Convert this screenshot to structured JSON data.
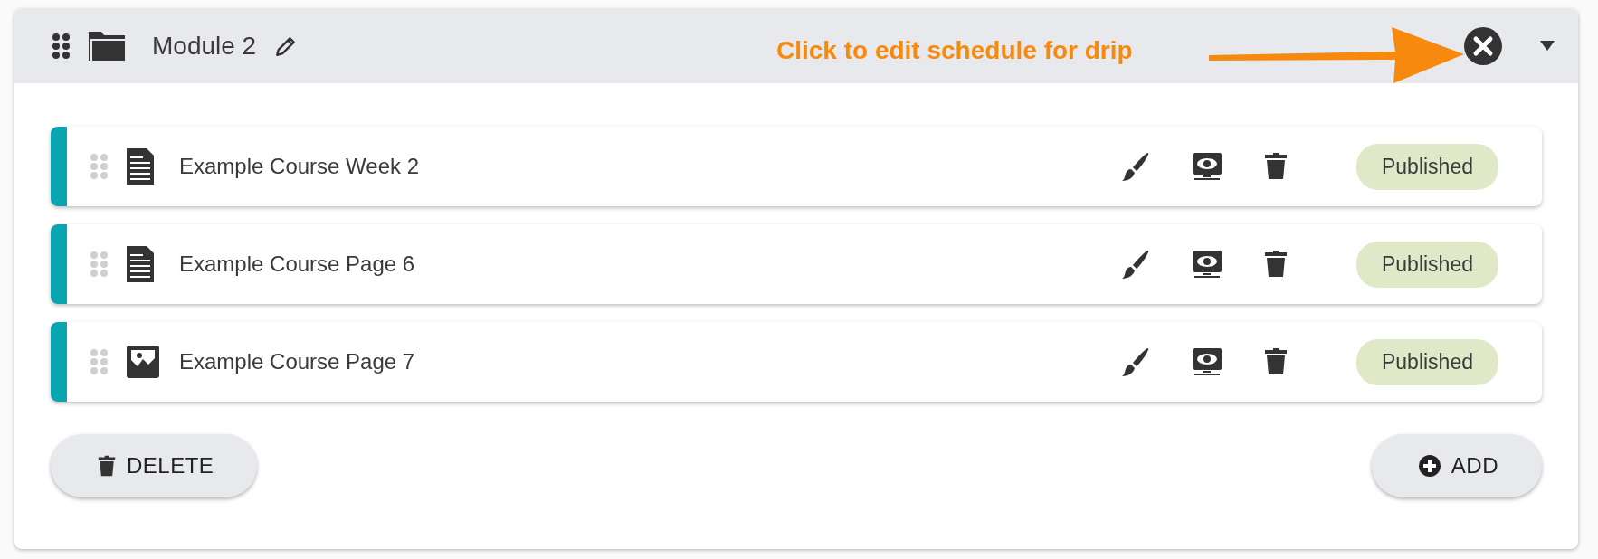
{
  "module": {
    "title": "Module 2",
    "expanded": true
  },
  "annotation": {
    "text": "Click to edit schedule for drip"
  },
  "items": [
    {
      "kind": "page",
      "title": "Example Course Week 2",
      "status": "Published"
    },
    {
      "kind": "page",
      "title": "Example Course Page 6",
      "status": "Published"
    },
    {
      "kind": "image",
      "title": "Example Course Page 7",
      "status": "Published"
    }
  ],
  "buttons": [
    {
      "kind": "delete",
      "label": "DELETE"
    },
    {
      "kind": "add",
      "label": "ADD"
    }
  ]
}
